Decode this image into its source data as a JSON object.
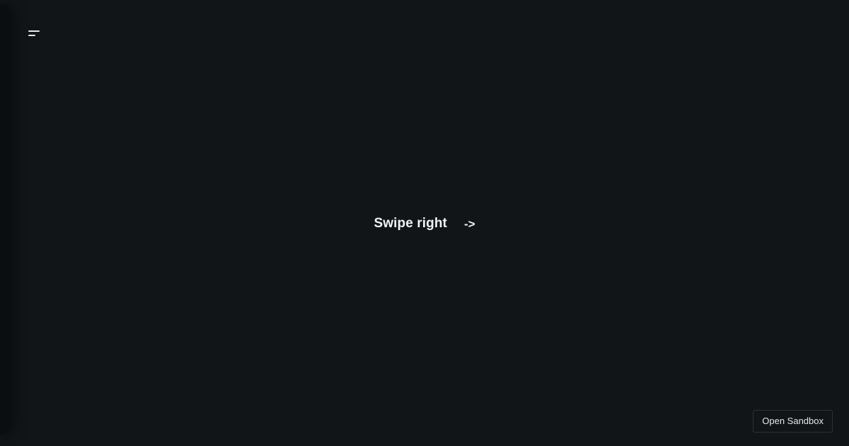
{
  "menu": {
    "icon": "menu-icon"
  },
  "main": {
    "prompt_label": "Swipe right",
    "prompt_arrow": "->"
  },
  "footer": {
    "sandbox_button_label": "Open Sandbox"
  },
  "colors": {
    "background": "#111518",
    "drawer": "#0b0e10",
    "text": "#f2f2f2",
    "button_border": "#2c3136"
  }
}
